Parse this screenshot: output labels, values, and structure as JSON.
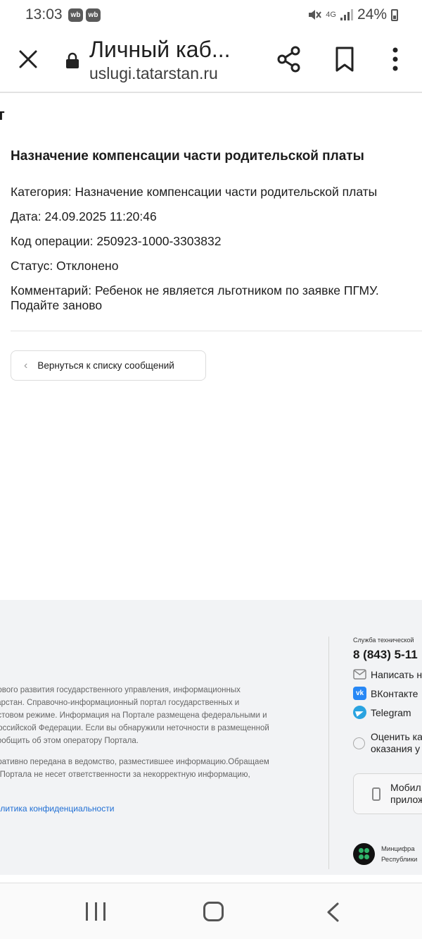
{
  "status_bar": {
    "time": "13:03",
    "badges": [
      "wb",
      "wb"
    ],
    "network": "4G",
    "battery": "24%",
    "icons": [
      "mute-icon",
      "signal-icon",
      "battery-icon"
    ]
  },
  "toolbar": {
    "page_title": "Личный каб...",
    "url": "uslugi.tatarstan.ru",
    "icons": [
      "close-icon",
      "lock-icon",
      "share-icon",
      "bookmark-icon",
      "more-vert-icon"
    ]
  },
  "page": {
    "cut_heading": "т",
    "message": {
      "title": "Назначение компенсации части родительской платы",
      "category": "Категория: Назначение компенсации части родительской платы",
      "date": "Дата: 24.09.2025 11:20:46",
      "operation_code": "Код операции: 250923-1000-3303832",
      "status": "Статус: Отклонено",
      "comment_line1": "Комментарий: Ребенок не является льготником по заявке ПГМУ.",
      "comment_line2": "Подайте заново"
    },
    "back_button": {
      "chevron": "‹",
      "label": "Вернуться к списку сообщений"
    }
  },
  "footer": {
    "text_lines": [
      "рового развития государственного управления, информационных",
      "тарстан. Справочно-информационный портал государственных и",
      "естовом режиме. Информация на Портале размещена федеральными и",
      "Российской Федерации. Если вы обнаружили неточности в размещенной",
      " сообщить об этом оператору Портала."
    ],
    "text_lines_2": [
      "еративно передана в ведомство, разместившее информацию.Обращаем",
      "о Портала не несет ответственности за некорректную информацию,"
    ],
    "privacy_link": "олитика конфиденциальности",
    "support_label": "Служба технической",
    "phone": "8 (843) 5-11",
    "write_label": "Написать н",
    "vk_label": "ВКонтакте",
    "telegram_label": "Telegram",
    "rate_line1": "Оценить ка",
    "rate_line2": "оказания у",
    "mobile_line1": "Мобил",
    "mobile_line2": "прилож",
    "ministry_line1": "Минцифра",
    "ministry_line2": "Республики"
  },
  "colors": {
    "link": "#1f6ed4",
    "footer_bg": "#f2f3f5",
    "vk": "#2787f5",
    "telegram": "#2aa3e0"
  }
}
